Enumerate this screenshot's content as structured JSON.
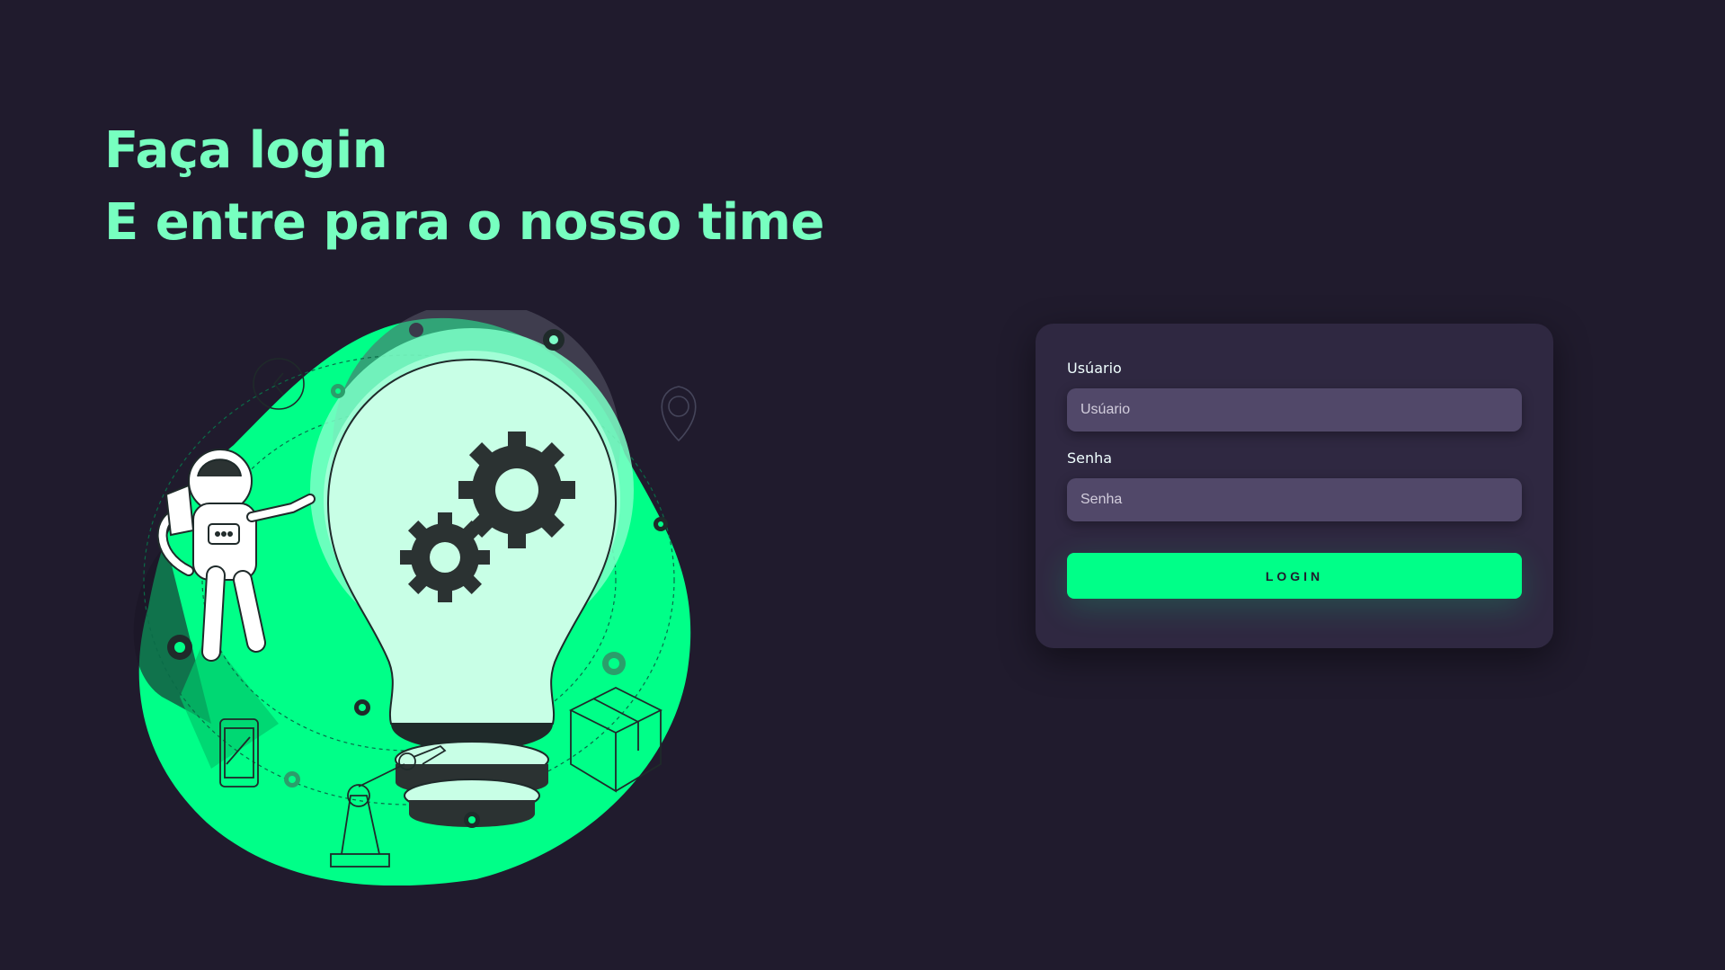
{
  "heading": {
    "line1": "Faça login",
    "line2": "E entre para o nosso time"
  },
  "form": {
    "username": {
      "label": "Usúario",
      "placeholder": "Usúario"
    },
    "password": {
      "label": "Senha",
      "placeholder": "Senha"
    },
    "submit_label": "LOGIN"
  },
  "colors": {
    "background": "#201b2d",
    "accent": "#00ff88",
    "heading": "#77ffc0",
    "card": "#2f2841",
    "input": "#514869"
  },
  "illustration": {
    "icons": [
      "lightbulb-icon",
      "gears-icon",
      "astronaut-icon",
      "robot-arm-icon",
      "smartphone-icon",
      "box-icon",
      "location-pin-icon",
      "clock-icon"
    ]
  }
}
